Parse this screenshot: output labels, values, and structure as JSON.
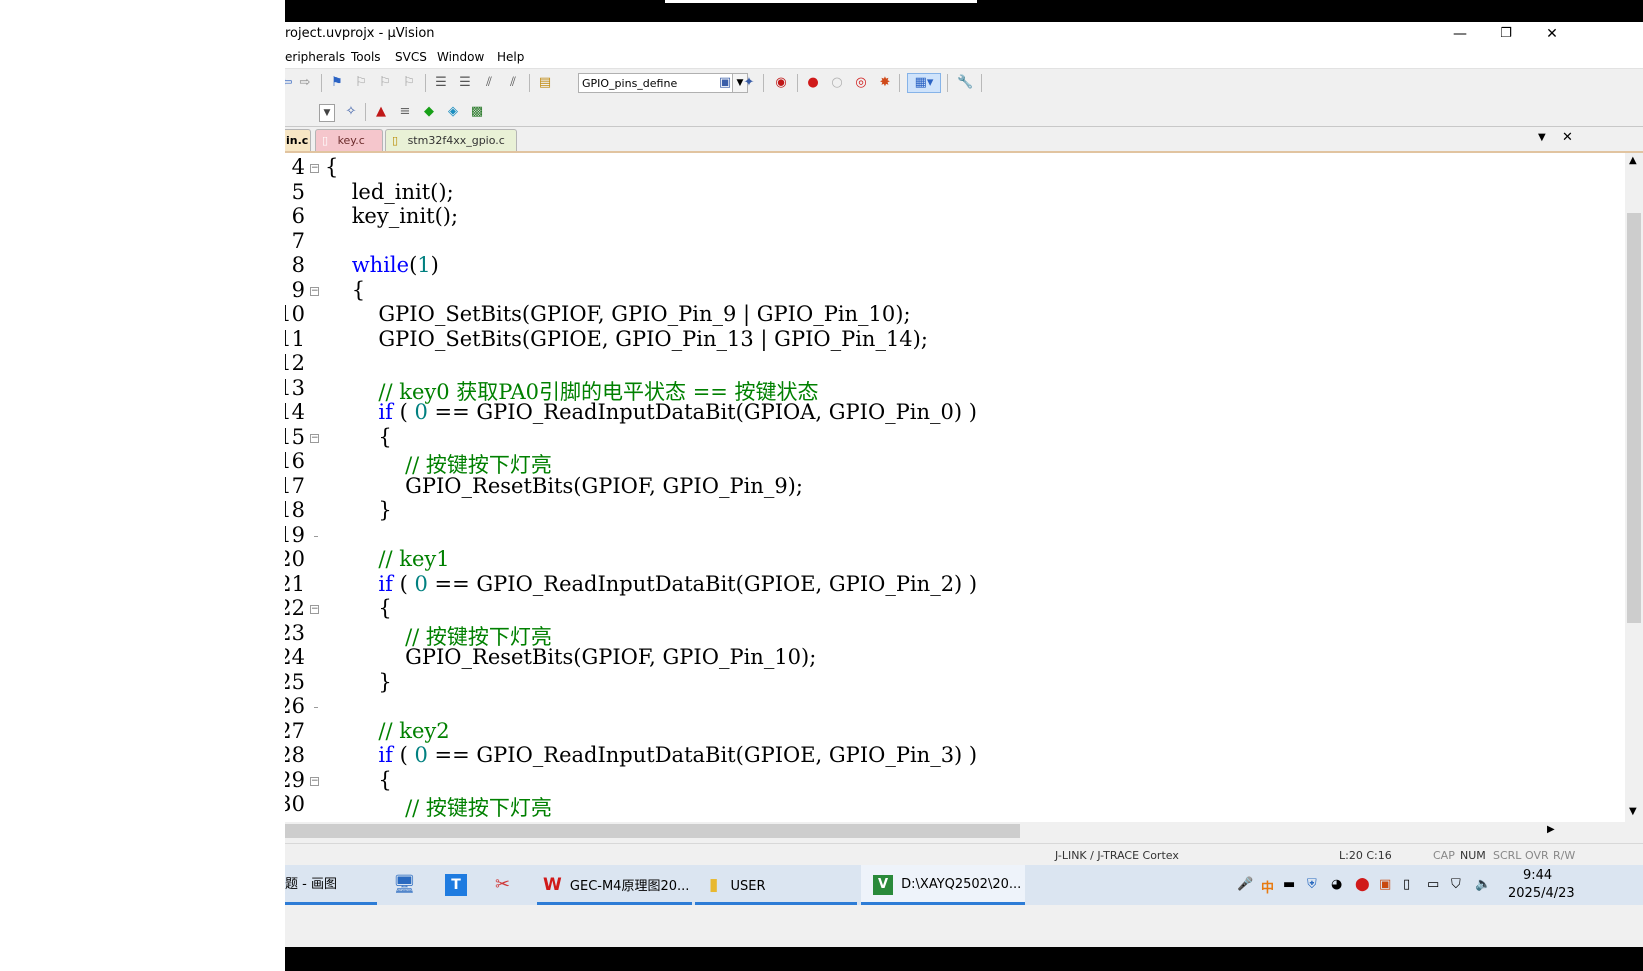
{
  "window": {
    "title": "roject.uvprojx - µVision",
    "minimize_glyph": "—",
    "restore_glyph": "❐",
    "close_glyph": "✕"
  },
  "menu": [
    "eripherals",
    "Tools",
    "SVCS",
    "Window",
    "Help"
  ],
  "toolbar": {
    "target": "GPIO_pins_define",
    "dropdown_glyph": "▼"
  },
  "tabs": [
    {
      "label": "in.c"
    },
    {
      "label": "key.c"
    },
    {
      "label": "stm32f4xx_gpio.c"
    }
  ],
  "tabbar_controls": {
    "menu_glyph": "▼",
    "close_glyph": "✕"
  },
  "editor": {
    "lines": [
      {
        "n": "4",
        "text": "{"
      },
      {
        "n": "5",
        "text": "    led_init();"
      },
      {
        "n": "6",
        "text": "    key_init();"
      },
      {
        "n": "7",
        "text": ""
      },
      {
        "n": "8",
        "kw": "while",
        "text": "(1)"
      },
      {
        "n": "9",
        "text": "    {"
      },
      {
        "n": "10",
        "text": "        GPIO_SetBits(GPIOF, GPIO_Pin_9 | GPIO_Pin_10);"
      },
      {
        "n": "11",
        "text": "        GPIO_SetBits(GPIOE, GPIO_Pin_13 | GPIO_Pin_14);"
      },
      {
        "n": "12",
        "text": ""
      },
      {
        "n": "13",
        "comment": "// key0 获取PA0引脚的电平状态 == 按键状态"
      },
      {
        "n": "14",
        "kw": "if",
        "text": " ( 0 == GPIO_ReadInputDataBit(GPIOA, GPIO_Pin_0) )"
      },
      {
        "n": "15",
        "text": "        {"
      },
      {
        "n": "16",
        "comment": "// 按键按下灯亮"
      },
      {
        "n": "17",
        "text": "            GPIO_ResetBits(GPIOF, GPIO_Pin_9);"
      },
      {
        "n": "18",
        "text": "        }"
      },
      {
        "n": "19",
        "text": ""
      },
      {
        "n": "20",
        "comment": "// key1"
      },
      {
        "n": "21",
        "kw": "if",
        "text": " ( 0 == GPIO_ReadInputDataBit(GPIOE, GPIO_Pin_2) )"
      },
      {
        "n": "22",
        "text": "        {"
      },
      {
        "n": "23",
        "comment": "// 按键按下灯亮"
      },
      {
        "n": "24",
        "text": "            GPIO_ResetBits(GPIOF, GPIO_Pin_10);"
      },
      {
        "n": "25",
        "text": "        }"
      },
      {
        "n": "26",
        "text": ""
      },
      {
        "n": "27",
        "comment": "// key2"
      },
      {
        "n": "28",
        "kw": "if",
        "text": " ( 0 == GPIO_ReadInputDataBit(GPIOE, GPIO_Pin_3) )"
      },
      {
        "n": "29",
        "text": "        {"
      },
      {
        "n": "30",
        "comment": "// 按键按下灯亮"
      }
    ]
  },
  "statusbar": {
    "debugger": "J-LINK / J-TRACE Cortex",
    "position": "L:20 C:16",
    "cap": "CAP",
    "num": "NUM",
    "scrl": "SCRL",
    "ovr": "OVR",
    "rw": "R/W"
  },
  "taskbar": {
    "items": [
      {
        "label": "题 - 画图"
      },
      {
        "label": "GEC-M4原理图20..."
      },
      {
        "label": "USER"
      },
      {
        "label": "D:\\XAYQ2502\\20..."
      }
    ],
    "time": "9:44",
    "date": "2025/4/23"
  },
  "colors": {
    "keyword": "#0000ff",
    "comment": "#008000",
    "number": "#008080",
    "tab_active": "#f7e6c4",
    "tab_key": "#f5c6cc",
    "tab_gpio": "#e9f1d6"
  }
}
